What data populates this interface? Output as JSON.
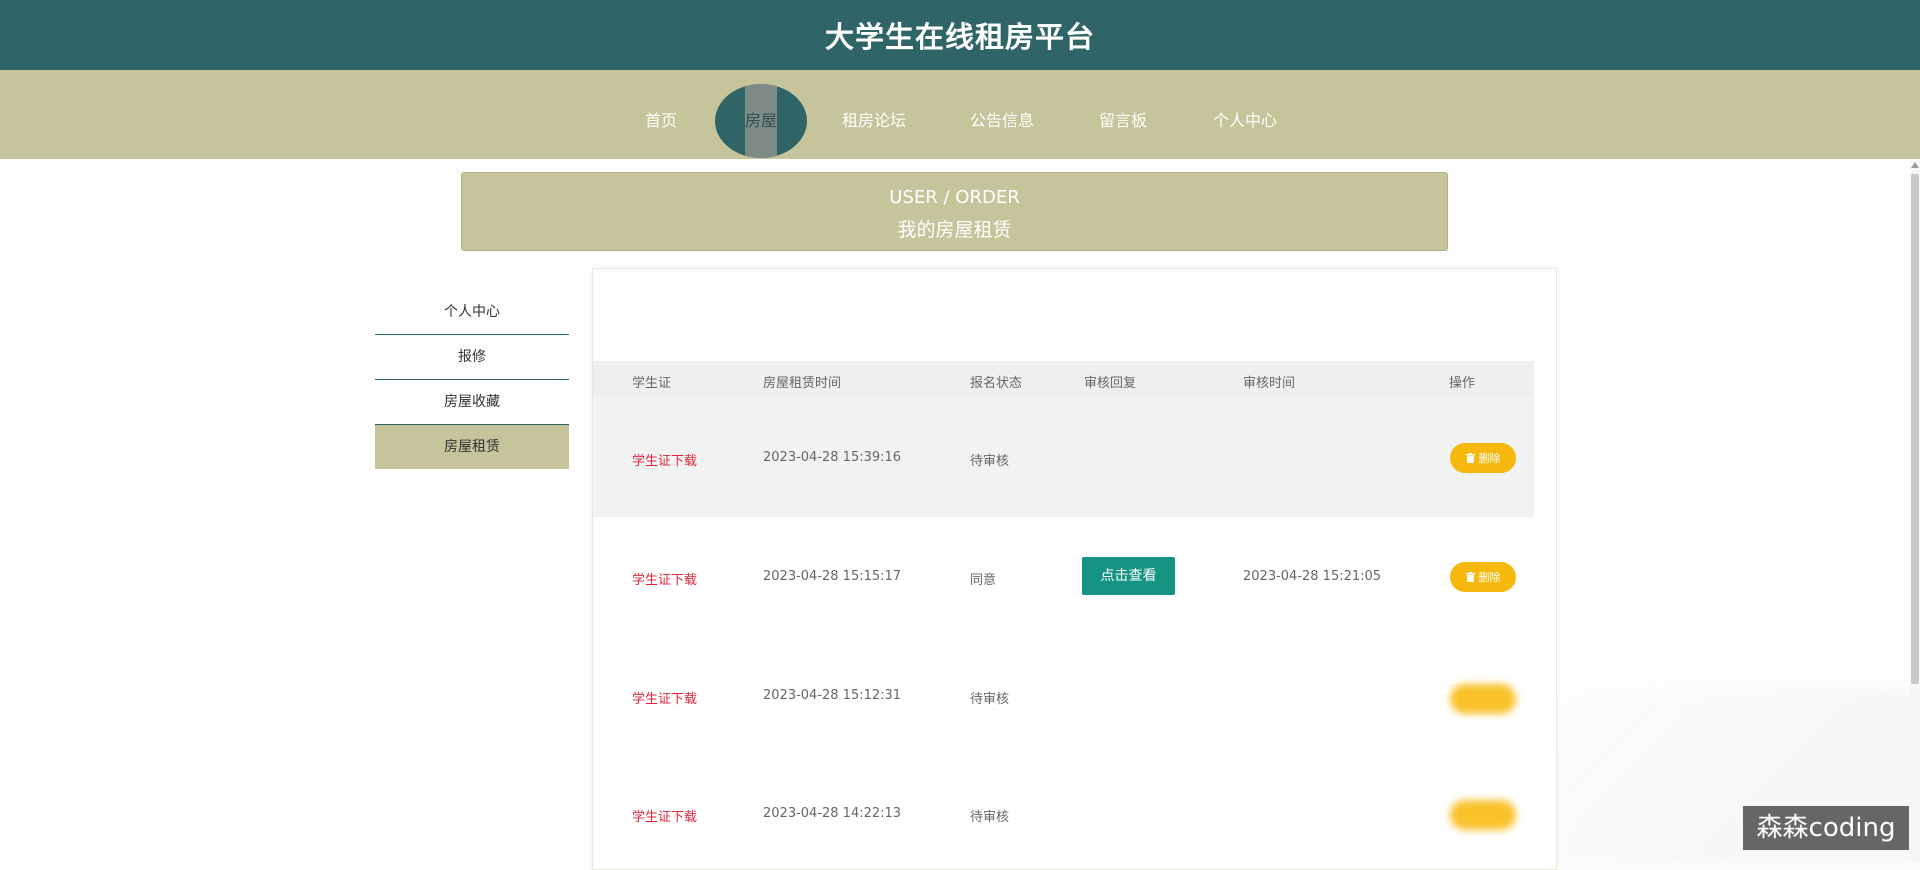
{
  "app": {
    "title": "大学生在线租房平台"
  },
  "nav": {
    "items": [
      {
        "label": "首页"
      },
      {
        "label": "房屋"
      },
      {
        "label": "租房论坛"
      },
      {
        "label": "公告信息"
      },
      {
        "label": "留言板"
      },
      {
        "label": "个人中心"
      }
    ]
  },
  "banner": {
    "en": "USER / ORDER",
    "cn": "我的房屋租赁"
  },
  "sidebar": {
    "items": [
      {
        "label": "个人中心"
      },
      {
        "label": "报修"
      },
      {
        "label": "房屋收藏"
      },
      {
        "label": "房屋租赁"
      }
    ]
  },
  "table": {
    "headers": [
      "学生证",
      "房屋租赁时间",
      "报名状态",
      "审核回复",
      "审核时间",
      "操作"
    ],
    "rows": [
      {
        "student_id": "学生证下载",
        "rent_time": "2023-04-28 15:39:16",
        "status": "待审核",
        "reply": "",
        "review_time": "",
        "action": "删除"
      },
      {
        "student_id": "学生证下载",
        "rent_time": "2023-04-28 15:15:17",
        "status": "同意",
        "reply": "点击查看",
        "review_time": "2023-04-28 15:21:05",
        "action": "删除"
      },
      {
        "student_id": "学生证下载",
        "rent_time": "2023-04-28 15:12:31",
        "status": "待审核",
        "reply": "",
        "review_time": "",
        "action": ""
      },
      {
        "student_id": "学生证下载",
        "rent_time": "2023-04-28 14:22:13",
        "status": "待审核",
        "reply": "",
        "review_time": "",
        "action": ""
      }
    ]
  },
  "watermark": "森森coding",
  "colors": {
    "primary": "#2f6566",
    "secondary": "#c5c49a",
    "link": "#e0263c",
    "view_button": "#169482",
    "delete_button": "#f6b80d"
  }
}
